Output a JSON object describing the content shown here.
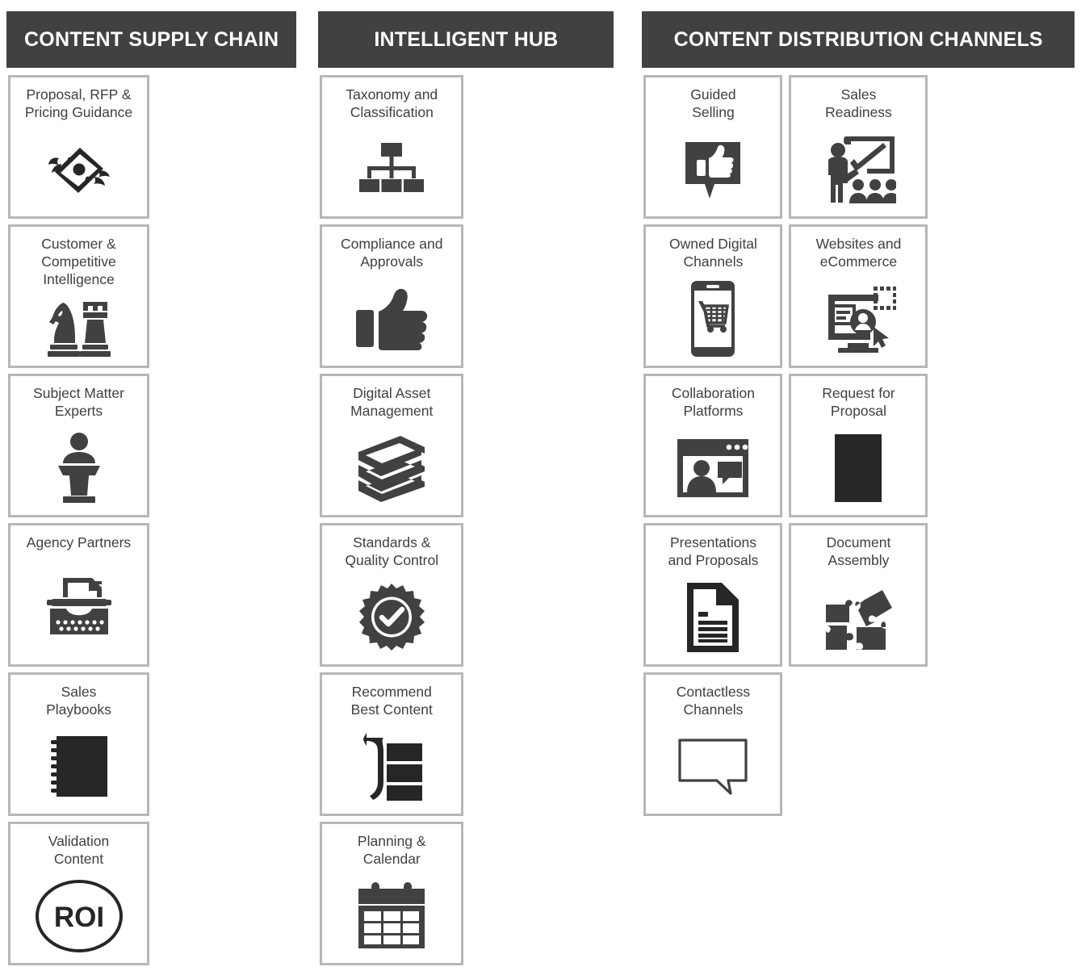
{
  "theme": {
    "header_bg": "#414141",
    "header_text": "#ffffff",
    "card_border": "#b7b7b7",
    "card_bg": "#ffffff",
    "label_color": "#404040",
    "icon_color": "#414141"
  },
  "groups": [
    {
      "id": "content-supply-chain",
      "title": "CONTENT SUPPLY CHAIN",
      "cards": [
        {
          "label": "Proposal, RFP &\nPricing Guidance",
          "icon": "flying-money-icon"
        },
        {
          "label": "Customer &\nCompetitive\nIntelligence",
          "icon": "chess-pieces-icon"
        },
        {
          "label": "Subject Matter\nExperts",
          "icon": "speaker-podium-icon"
        },
        {
          "label": "Agency Partners",
          "icon": "typewriter-icon"
        },
        {
          "label": "Sales\nPlaybooks",
          "icon": "playbook-strategy-icon"
        },
        {
          "label": "Validation\nContent",
          "icon": "roi-circle-icon",
          "icon_text": "ROI"
        }
      ]
    },
    {
      "id": "intelligent-hub",
      "title": "INTELLIGENT HUB",
      "cards": [
        {
          "label": "Taxonomy and\nClassification",
          "icon": "hierarchy-tree-icon"
        },
        {
          "label": "Compliance and\nApprovals",
          "icon": "thumbs-up-icon"
        },
        {
          "label": "Digital Asset\nManagement",
          "icon": "book-stack-icon"
        },
        {
          "label": "Standards &\nQuality Control",
          "icon": "quality-seal-check-icon"
        },
        {
          "label": "Recommend\nBest Content",
          "icon": "arrow-list-icon"
        },
        {
          "label": "Planning &\nCalendar",
          "icon": "calendar-icon"
        }
      ]
    },
    {
      "id": "content-distribution-channels",
      "title": "CONTENT DISTRIBUTION CHANNELS",
      "cards": [
        {
          "label": "Guided\nSelling",
          "icon": "chat-thumbs-up-icon"
        },
        {
          "label": "Sales\nReadiness",
          "icon": "training-presenter-icon"
        },
        {
          "label": "Owned Digital\nChannels",
          "icon": "mobile-shopping-cart-icon"
        },
        {
          "label": "Websites and\neCommerce",
          "icon": "desktop-user-cursor-icon"
        },
        {
          "label": "Collaboration\nPlatforms",
          "icon": "browser-chat-user-icon"
        },
        {
          "label": "Request for\nProposal",
          "icon": "checklist-clipboard-icon"
        },
        {
          "label": "Presentations\nand Proposals",
          "icon": "document-lines-icon"
        },
        {
          "label": "Document\nAssembly",
          "icon": "puzzle-pieces-icon"
        },
        {
          "label": "Contactless\nChannels",
          "icon": "speech-bubble-outline-icon"
        }
      ]
    }
  ]
}
